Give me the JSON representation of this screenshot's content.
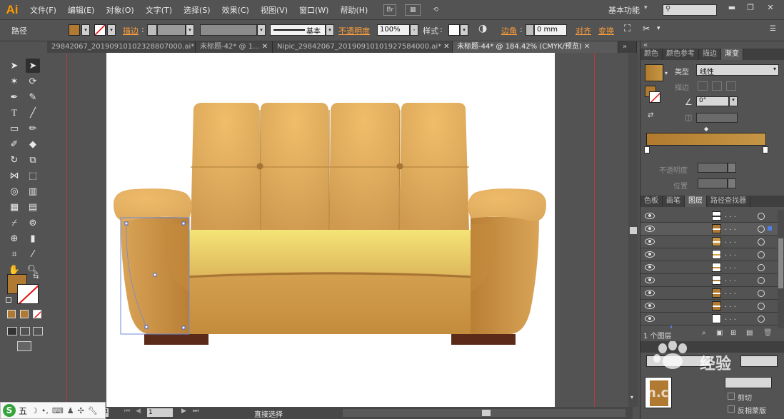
{
  "app": {
    "logo": "Ai"
  },
  "menu": [
    "文件(F)",
    "编辑(E)",
    "对象(O)",
    "文字(T)",
    "选择(S)",
    "效果(C)",
    "视图(V)",
    "窗口(W)",
    "帮助(H)"
  ],
  "menubar": {
    "br_label": "Br",
    "workspace": "基本功能",
    "window_controls": [
      "▬",
      "❐",
      "✕"
    ]
  },
  "control_bar": {
    "selection_label": "路径",
    "stroke_label": "描边",
    "stroke_sep": ":",
    "stroke_style": "基本",
    "opacity_label": "不透明度",
    "opacity_value": "100%",
    "style_label": "样式",
    "style_sep": ":",
    "corner_label": "边角",
    "corner_sep": ":",
    "corner_value": "0 mm",
    "align_label": "对齐",
    "transform_label": "变换",
    "colors": {
      "fill": "#b07a33",
      "accent": "#ff9d3a"
    }
  },
  "doc_tabs": [
    {
      "label": "29842067_20190910102328807000.ai*",
      "active": false
    },
    {
      "label": "未标题-42* @ 1...",
      "active": false
    },
    {
      "label": "Nipic_29842067_20190910101927584000.ai*",
      "active": false
    },
    {
      "label": "未标题-44* @ 184.42% (CMYK/预览)",
      "active": true
    }
  ],
  "tab_close_glyph": "✕",
  "scroll_arrows": {
    "doc_tabs": "»",
    "right_panel": "«"
  },
  "right_panel": {
    "top_tabs": [
      "颜色",
      "颜色参考",
      "描边",
      "渐变"
    ],
    "gradient": {
      "type_label": "类型",
      "type_value": "线性",
      "stroke_label": "描边",
      "angle_value": "0°",
      "opacity_label": "不透明度",
      "position_label": "位置",
      "colors": [
        "#b17a2e",
        "#c59645"
      ]
    },
    "layer_tabs": [
      "色板",
      "画笔",
      "图层",
      "路径查找器"
    ],
    "layers_footer": "1 个图层",
    "extra_labels": {
      "clip": "剪切",
      "invert_mask": "反相蒙版"
    }
  },
  "layers": [
    {
      "thumb": "#ffffff",
      "stripe": "#333333"
    },
    {
      "thumb": "#b07a33",
      "stripe": "#ffffff",
      "selected": true
    },
    {
      "thumb": "#c59645",
      "stripe": "#ffffff"
    },
    {
      "thumb": "#ffffff",
      "stripe": "#d9a650"
    },
    {
      "thumb": "#ffffff",
      "stripe": "#c9903c"
    },
    {
      "thumb": "#ffffff",
      "stripe": "#a87a32"
    },
    {
      "thumb": "#b07a33",
      "stripe": "#ffffff"
    },
    {
      "thumb": "#b07a33",
      "stripe": "#ffffff"
    },
    {
      "thumb": "#ffffff",
      "stripe": "#ffffff"
    }
  ],
  "status": {
    "zoom": "184.42%",
    "page": "1",
    "tool": "直接选择"
  },
  "ime": {
    "mode": "五"
  },
  "watermark": {
    "text": "经验",
    "sub": "n.c"
  },
  "sofa_colors": {
    "back": "#dca85c",
    "seat": "#f1e07a",
    "arm": "#c98c3d",
    "legs": "#5c2a18"
  }
}
